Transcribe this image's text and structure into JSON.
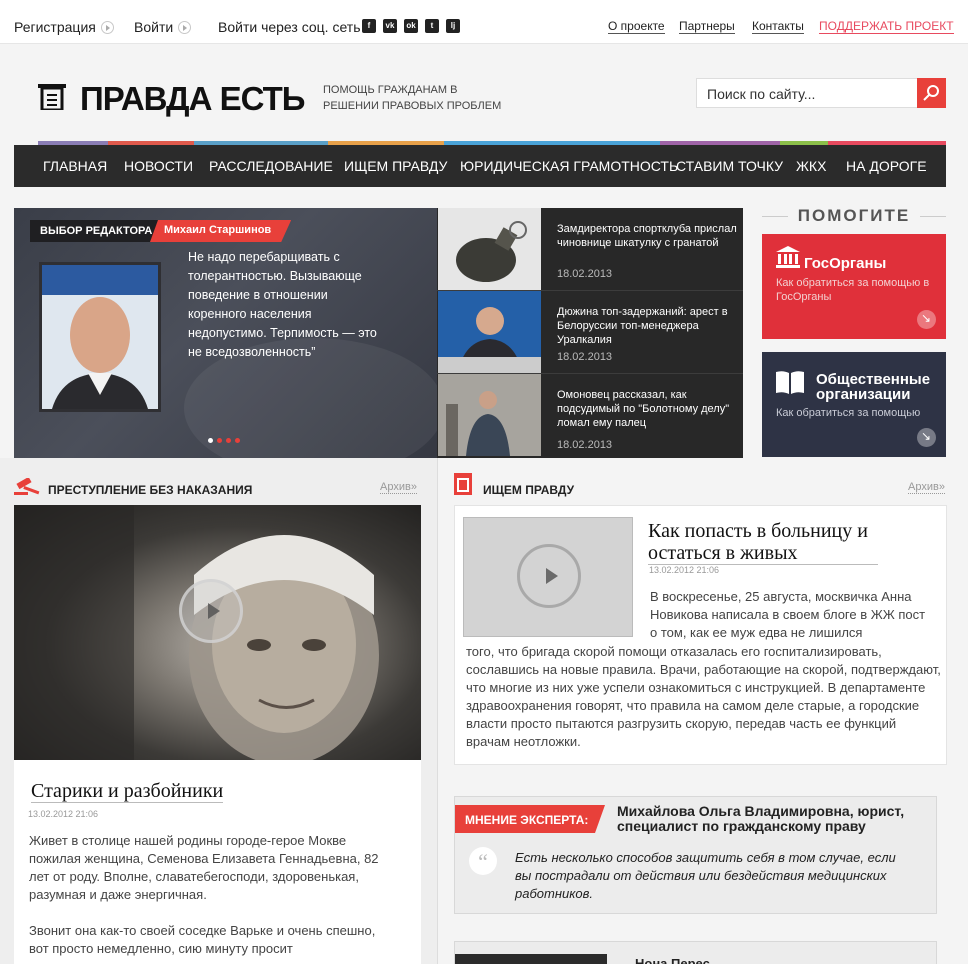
{
  "topbar": {
    "register": "Регистрация",
    "login": "Войти",
    "social_login": "Войти через соц. сеть",
    "social_icons": [
      "facebook-icon",
      "vk-icon",
      "odnoklassniki-icon",
      "twitter-icon",
      "livejournal-icon"
    ],
    "links": [
      "О проекте",
      "Партнеры",
      "Контакты"
    ],
    "support": "ПОДДЕРЖАТЬ ПРОЕКТ"
  },
  "header": {
    "logo": "ПРАВДА ЕСТЬ",
    "slogan": "ПОМОЩЬ ГРАЖДАНАМ В РЕШЕНИИ ПРАВОВЫХ ПРОБЛЕМ",
    "search_placeholder": "Поиск по сайту..."
  },
  "nav": {
    "items": [
      "ГЛАВНАЯ",
      "НОВОСТИ",
      "РАССЛЕДОВАНИЕ",
      "ИЩЕМ ПРАВДУ",
      "ЮРИДИЧЕСКАЯ ГРАМОТНОСТЬ",
      "СТАВИМ ТОЧКУ",
      "ЖКХ",
      "НА ДОРОГЕ"
    ],
    "colors": [
      "#8a7db5",
      "#e05a4c",
      "#5aa0c8",
      "#e8a14a",
      "#4aa3d8",
      "#a064a8",
      "#8cc04a",
      "#e84a5f"
    ]
  },
  "slider": {
    "editor_label": "ВЫБОР РЕДАКТОРА",
    "author": "Михаил  Старшинов",
    "quote": "Не надо перебарщивать с толерантностью. Вызывающе поведение в отношении коренного населения недопустимо. Терпимость — это не вседозволенность”",
    "dot_count": 4
  },
  "news": [
    {
      "title": "Замдиректора спортклуба прислал чиновнице шкатулку с гранатой",
      "date": "18.02.2013"
    },
    {
      "title": "Дюжина топ-задержаний: арест в Белоруссии топ-менеджера Уралкалия",
      "date": "18.02.2013"
    },
    {
      "title": "Омоновец рассказал, как подсудимый по \"Болотному делу\" ломал ему палец",
      "date": "18.02.2013"
    }
  ],
  "help": {
    "title": "ПОМОГИТЕ",
    "boxes": [
      {
        "title": "ГосОрганы",
        "subtitle": "Как обратиться за помощью в ГосОрганы",
        "color": "#e0303a"
      },
      {
        "title": "Общественные организации",
        "subtitle": "Как обратиться за помощью",
        "color": "#2e3345"
      }
    ]
  },
  "section_left": {
    "title": "ПРЕСТУПЛЕНИЕ БЕЗ НАКАЗАНИЯ",
    "archive": "Архив»",
    "article": {
      "title": "Старики и разбойники",
      "date": "13.02.2012 21:06",
      "p1": "Живет в столице нашей родины городе-герое Мокве пожилая женщина, Семенова Елизавета Геннадьевна, 82 лет от роду. Вполне, славатебегосподи, здоровенькая, разумная и даже энергичная.",
      "p2": "Звонит она как-то своей соседке Варьке и очень спешно, вот просто немедленно, сию минуту просит"
    }
  },
  "section_right": {
    "title": "ИЩЕМ ПРАВДУ",
    "archive": "Архив»",
    "article": {
      "title": "Как попасть в больницу и остаться в живых",
      "date": "13.02.2012 21:06",
      "text_top": "В воскресенье, 25 августа, москвичка Анна Новикова написала в своем блоге в ЖЖ пост о том, как ее муж едва не лишился",
      "text_bottom": "того, что бригада скорой помощи отказалась его госпитализировать, сославшись на новые правила. Врачи, работающие на скорой, подтверждают, что многие из них уже успели ознакомиться с инструкцией. В департаменте здравоохранения говорят, что правила на самом деле старые, а городские власти просто пытаются разгрузить скорую, передав часть ее функций врачам неотложки."
    },
    "expert": {
      "label": "МНЕНИЕ ЭКСПЕРТА:",
      "name": "Михайлова Ольга Владимировна, юрист, специалист по  гражданскому праву",
      "quote": "Есть несколько способов защитить себя в том случае, если вы пострадали от действия или бездействия медицинских работников."
    },
    "next_name": "Нона Перес"
  }
}
